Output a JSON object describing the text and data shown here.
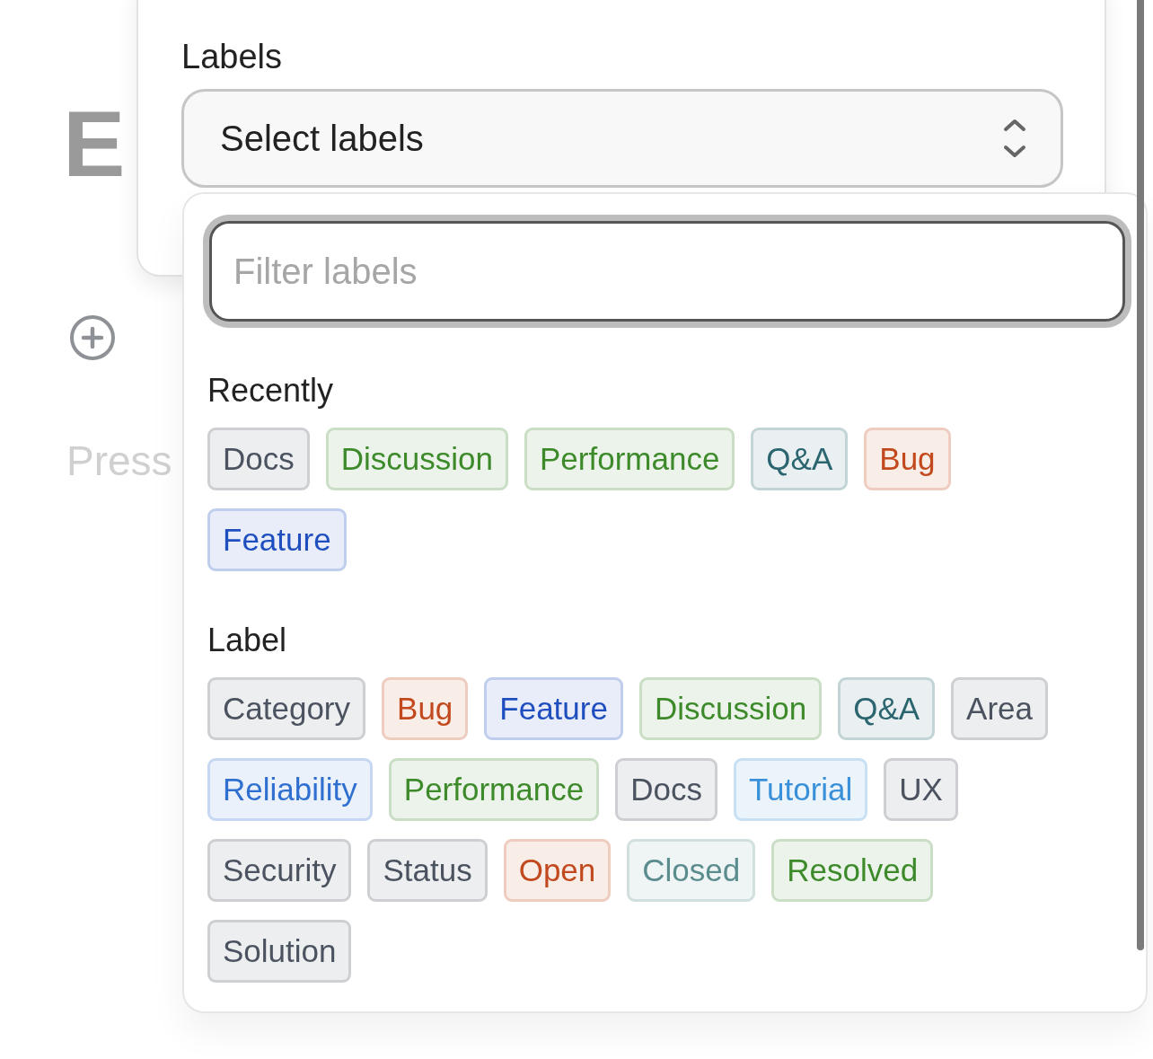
{
  "background": {
    "title": "E",
    "hint": "Press"
  },
  "labels_field": {
    "label": "Labels",
    "prompt": "Select labels"
  },
  "dropdown": {
    "filter": {
      "placeholder": "Filter labels"
    },
    "sections": [
      {
        "heading": "Recently",
        "tags": [
          {
            "label": "Docs",
            "color": "#4b5260"
          },
          {
            "label": "Discussion",
            "color": "#3d8a2b"
          },
          {
            "label": "Performance",
            "color": "#3d8a2b"
          },
          {
            "label": "Q&A",
            "color": "#2a6570"
          },
          {
            "label": "Bug",
            "color": "#c2491d"
          },
          {
            "label": "Feature",
            "color": "#1f4fbf"
          }
        ]
      },
      {
        "heading": "Label",
        "tags": [
          {
            "label": "Category",
            "color": "#4b5260"
          },
          {
            "label": "Bug",
            "color": "#c2491d"
          },
          {
            "label": "Feature",
            "color": "#1f4fbf"
          },
          {
            "label": "Discussion",
            "color": "#3d8a2b"
          },
          {
            "label": "Q&A",
            "color": "#2a6570"
          },
          {
            "label": "Area",
            "color": "#4b5260"
          },
          {
            "label": "Reliability",
            "color": "#2f6fd0"
          },
          {
            "label": "Performance",
            "color": "#3d8a2b"
          },
          {
            "label": "Docs",
            "color": "#4b5260"
          },
          {
            "label": "Tutorial",
            "color": "#3a90d8"
          },
          {
            "label": "UX",
            "color": "#4b5260"
          },
          {
            "label": "Security",
            "color": "#4b5260"
          },
          {
            "label": "Status",
            "color": "#4b5260"
          },
          {
            "label": "Open",
            "color": "#c2491d"
          },
          {
            "label": "Closed",
            "color": "#5a8c8e"
          },
          {
            "label": "Resolved",
            "color": "#3d8a2b"
          },
          {
            "label": "Solution",
            "color": "#4b5260"
          }
        ]
      }
    ]
  }
}
